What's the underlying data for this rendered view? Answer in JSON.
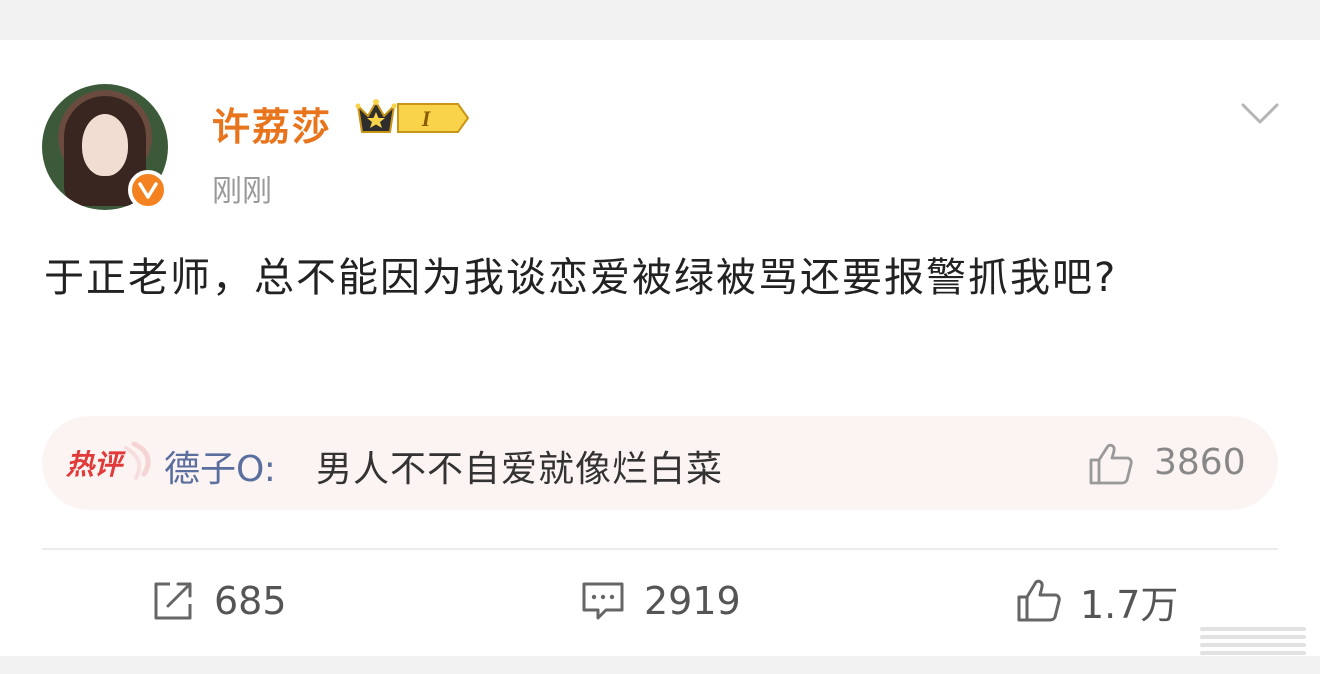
{
  "post": {
    "username": "许荔莎",
    "vip_level": "I",
    "timestamp": "刚刚",
    "text": "于正老师，总不能因为我谈恋爱被绿被骂还要报警抓我吧?"
  },
  "hot_comment": {
    "tag": "热评",
    "author": "德子O:",
    "text": "男人不不自爱就像烂白菜",
    "likes": "3860"
  },
  "actions": {
    "repost_count": "685",
    "comment_count": "2919",
    "like_count": "1.7万"
  },
  "colors": {
    "username": "#e8741c",
    "verified_badge": "#f58220",
    "comment_author": "#5b6f9e",
    "hot_tag": "#e03a3a"
  },
  "icons": {
    "verified": "verified-v-icon",
    "crown": "crown-icon",
    "menu": "chevron-down-icon",
    "repost": "repost-icon",
    "comment": "comment-icon",
    "like": "thumbs-up-icon"
  }
}
